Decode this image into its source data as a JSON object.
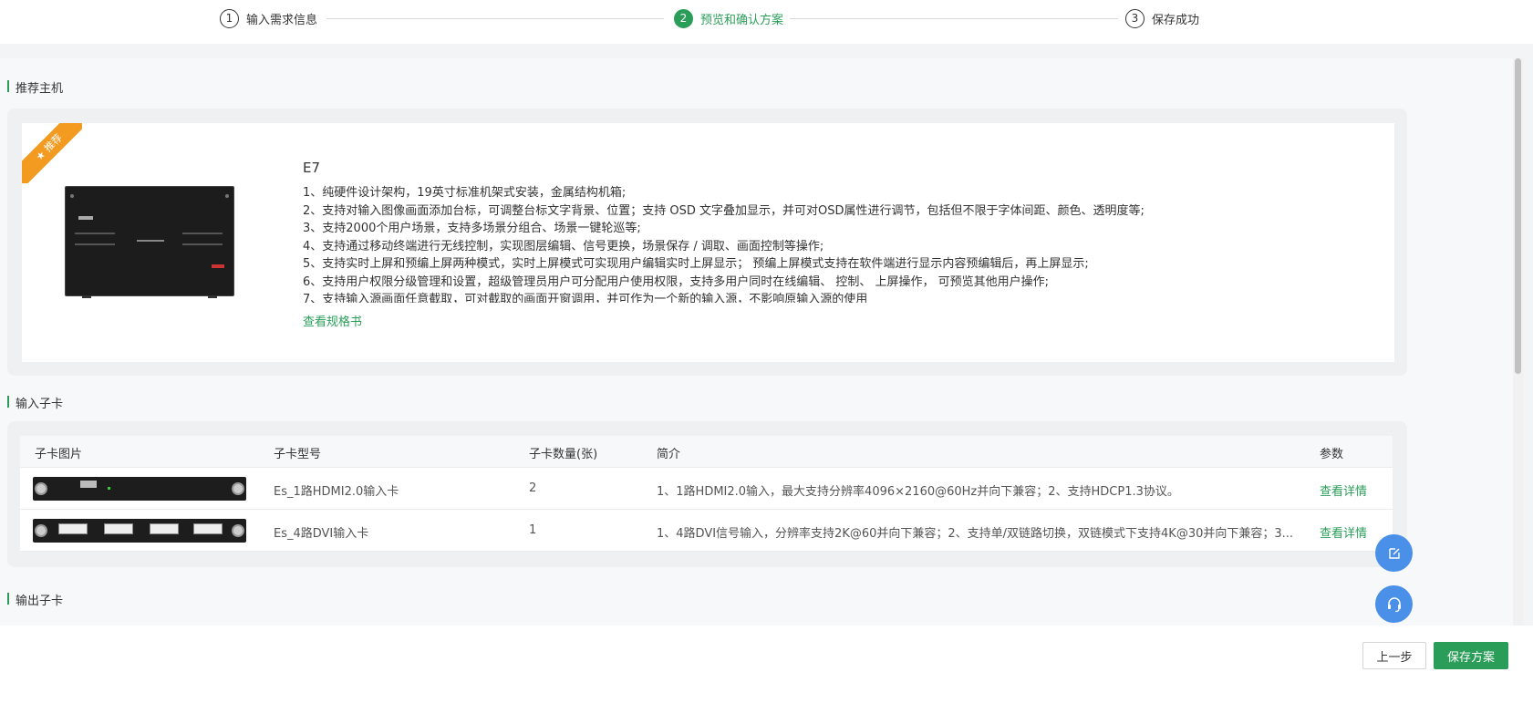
{
  "stepper": {
    "steps": [
      {
        "num": "1",
        "label": "输入需求信息"
      },
      {
        "num": "2",
        "label": "预览和确认方案"
      },
      {
        "num": "3",
        "label": "保存成功"
      }
    ]
  },
  "sections": {
    "host_title": "推荐主机",
    "input_cards_title": "输入子卡",
    "output_cards_title": "输出子卡"
  },
  "host": {
    "badge": "★ 推荐",
    "name": "E7",
    "features": [
      "1、纯硬件设计架构，19英寸标准机架式安装，金属结构机箱;",
      "2、支持对输入图像画面添加台标，可调整台标文字背景、位置；支持 OSD 文字叠加显示，并可对OSD属性进行调节，包括但不限于字体间距、颜色、透明度等;",
      "3、支持2000个用户场景，支持多场景分组合、场景一键轮巡等;",
      "4、支持通过移动终端进行无线控制，实现图层编辑、信号更换，场景保存 / 调取、画面控制等操作;",
      "5、支持实时上屏和预编上屏两种模式，实时上屏模式可实现用户编辑实时上屏显示； 预编上屏模式支持在软件端进行显示内容预编辑后，再上屏显示;",
      "6、支持用户权限分级管理和设置，超级管理员用户可分配用户使用权限，支持多用户同时在线编辑、 控制、 上屏操作， 可预览其他用户操作;",
      "7、支持输入源画面任意截取，可对截取的画面开窗调用，并可作为一个新的输入源，不影响原输入源的使用"
    ],
    "spec_link": "查看规格书"
  },
  "input_table": {
    "headers": {
      "image": "子卡图片",
      "model": "子卡型号",
      "qty": "子卡数量(张)",
      "intro": "简介",
      "params": "参数"
    },
    "rows": [
      {
        "model": "Es_1路HDMI2.0输入卡",
        "qty": "2",
        "intro": "1、1路HDMI2.0输入，最大支持分辨率4096×2160@60Hz并向下兼容；2、支持HDCP1.3协议。",
        "link": "查看详情"
      },
      {
        "model": "Es_4路DVI输入卡",
        "qty": "1",
        "intro": "1、4路DVI信号输入，分辨率支持2K@60并向下兼容；2、支持单/双链路切换，双链模式下支持4K@30并向下兼容；3...",
        "link": "查看详情"
      }
    ]
  },
  "footer": {
    "prev": "上一步",
    "save": "保存方案"
  },
  "colors": {
    "accent": "#2a9d59",
    "badge": "#f39a20",
    "float": "#4a90e8"
  },
  "icons": {
    "float_top": "edit-icon",
    "float_bottom": "headset-icon"
  }
}
